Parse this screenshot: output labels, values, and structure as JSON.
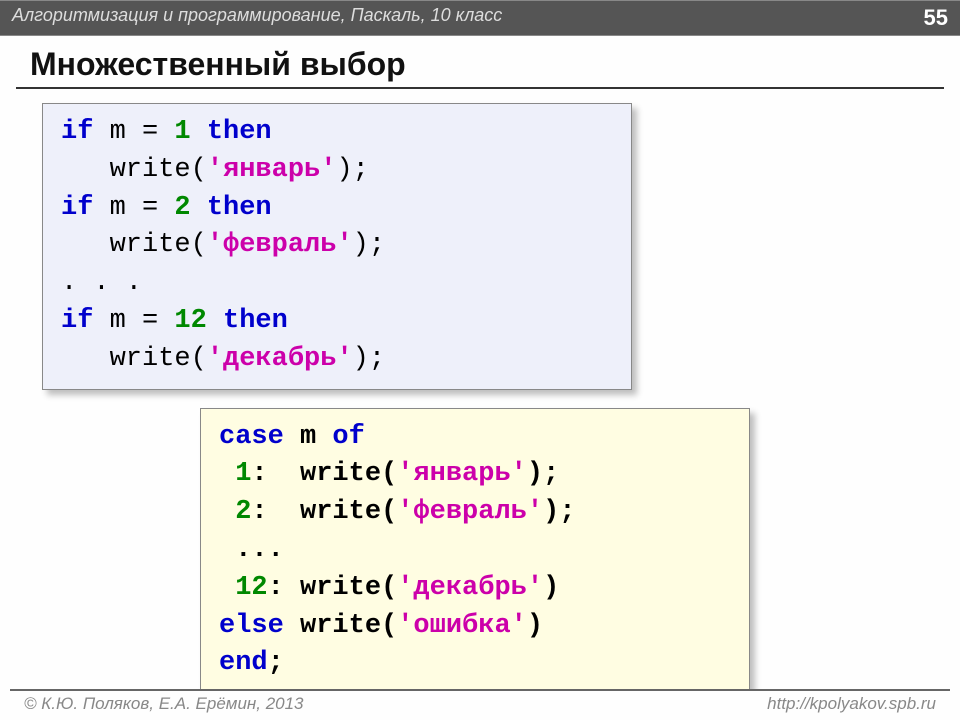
{
  "header": {
    "subject": "Алгоритмизация и программирование, Паскаль, 10 класс",
    "page": "55"
  },
  "title": "Множественный выбор",
  "code1": {
    "l1": {
      "a": "if",
      "b": " m = ",
      "c": "1",
      "d": " then"
    },
    "l2": {
      "a": "   write(",
      "b": "'январь'",
      "c": ");"
    },
    "l3": {
      "a": "if",
      "b": " m = ",
      "c": "2",
      "d": " then"
    },
    "l4": {
      "a": "   write(",
      "b": "'февраль'",
      "c": ");"
    },
    "l5": ". . .",
    "l6": {
      "a": "if",
      "b": " m = ",
      "c": "12",
      "d": " then"
    },
    "l7": {
      "a": "   write(",
      "b": "'декабрь'",
      "c": ");"
    }
  },
  "code2": {
    "l1": {
      "a": "case",
      "b": " m ",
      "c": "of"
    },
    "l2": {
      "a": " ",
      "b": "1",
      "c": ":  write(",
      "d": "'январь'",
      "e": ");"
    },
    "l3": {
      "a": " ",
      "b": "2",
      "c": ":  write(",
      "d": "'февраль'",
      "e": ");"
    },
    "l4": " ...",
    "l5": {
      "a": " ",
      "b": "12",
      "c": ": write(",
      "d": "'декабрь'",
      "e": ")"
    },
    "l6": {
      "a": "else",
      "b": " write(",
      "c": "'ошибка'",
      "d": ")"
    },
    "l7": {
      "a": "end",
      "b": ";"
    }
  },
  "footer": {
    "left": "© К.Ю. Поляков, Е.А. Ерёмин, 2013",
    "right": "http://kpolyakov.spb.ru"
  }
}
